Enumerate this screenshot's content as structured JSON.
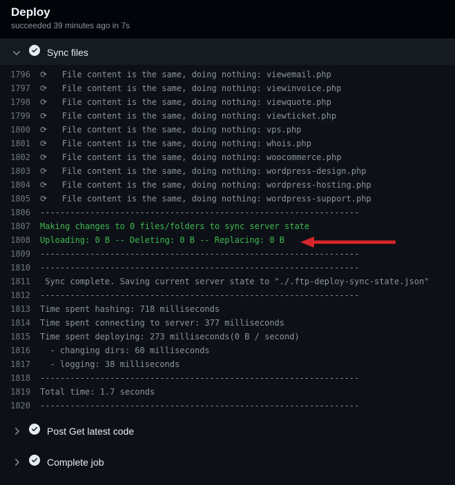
{
  "header": {
    "title": "Deploy",
    "subtitle": "succeeded 39 minutes ago in 7s"
  },
  "section": {
    "title": "Sync files"
  },
  "logs": [
    {
      "num": "1796",
      "prefix": "⟳",
      "text": "  File content is the same, doing nothing: viewemail.php",
      "green": false
    },
    {
      "num": "1797",
      "prefix": "⟳",
      "text": "  File content is the same, doing nothing: viewinvoice.php",
      "green": false
    },
    {
      "num": "1798",
      "prefix": "⟳",
      "text": "  File content is the same, doing nothing: viewquote.php",
      "green": false
    },
    {
      "num": "1799",
      "prefix": "⟳",
      "text": "  File content is the same, doing nothing: viewticket.php",
      "green": false
    },
    {
      "num": "1800",
      "prefix": "⟳",
      "text": "  File content is the same, doing nothing: vps.php",
      "green": false
    },
    {
      "num": "1801",
      "prefix": "⟳",
      "text": "  File content is the same, doing nothing: whois.php",
      "green": false
    },
    {
      "num": "1802",
      "prefix": "⟳",
      "text": "  File content is the same, doing nothing: woocommerce.php",
      "green": false
    },
    {
      "num": "1803",
      "prefix": "⟳",
      "text": "  File content is the same, doing nothing: wordpress-design.php",
      "green": false
    },
    {
      "num": "1804",
      "prefix": "⟳",
      "text": "  File content is the same, doing nothing: wordpress-hosting.php",
      "green": false
    },
    {
      "num": "1805",
      "prefix": "⟳",
      "text": "  File content is the same, doing nothing: wordpress-support.php",
      "green": false
    },
    {
      "num": "1806",
      "prefix": "",
      "text": "----------------------------------------------------------------",
      "green": false
    },
    {
      "num": "1807",
      "prefix": "",
      "text": "Making changes to 0 files/folders to sync server state",
      "green": true
    },
    {
      "num": "1808",
      "prefix": "",
      "text": "Uploading: 0 B -- Deleting: 0 B -- Replacing: 0 B",
      "green": true
    },
    {
      "num": "1809",
      "prefix": "",
      "text": "----------------------------------------------------------------",
      "green": false
    },
    {
      "num": "1810",
      "prefix": "",
      "text": "----------------------------------------------------------------",
      "green": false
    },
    {
      "num": "1811",
      "prefix": "",
      "text": " Sync complete. Saving current server state to \"./.ftp-deploy-sync-state.json\"",
      "green": false
    },
    {
      "num": "1812",
      "prefix": "",
      "text": "----------------------------------------------------------------",
      "green": false
    },
    {
      "num": "1813",
      "prefix": "",
      "text": "Time spent hashing: 718 milliseconds",
      "green": false
    },
    {
      "num": "1814",
      "prefix": "",
      "text": "Time spent connecting to server: 377 milliseconds",
      "green": false
    },
    {
      "num": "1815",
      "prefix": "",
      "text": "Time spent deploying: 273 milliseconds(0 B / second)",
      "green": false
    },
    {
      "num": "1816",
      "prefix": "",
      "text": "  - changing dirs: 60 milliseconds",
      "green": false
    },
    {
      "num": "1817",
      "prefix": "",
      "text": "  - logging: 38 milliseconds",
      "green": false
    },
    {
      "num": "1818",
      "prefix": "",
      "text": "----------------------------------------------------------------",
      "green": false
    },
    {
      "num": "1819",
      "prefix": "",
      "text": "Total time: 1.7 seconds",
      "green": false
    },
    {
      "num": "1820",
      "prefix": "",
      "text": "----------------------------------------------------------------",
      "green": false
    }
  ],
  "steps": [
    {
      "label": "Post  Get latest code"
    },
    {
      "label": "Complete job"
    }
  ]
}
